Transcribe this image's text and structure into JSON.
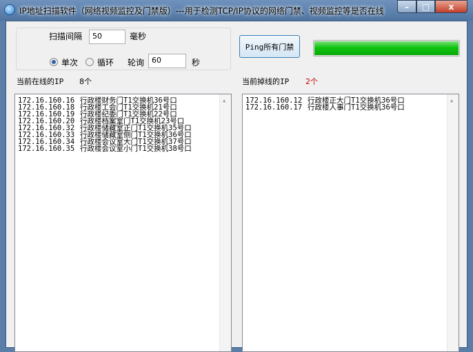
{
  "window": {
    "title": "IP地址扫描软件（网络视频监控及门禁版）---用于检测TCP/IP协议的网络门禁、视频监控等是否在线",
    "minimize": "–",
    "maximize": "□",
    "close": "x"
  },
  "settings": {
    "interval_label": "扫描间隔",
    "interval_value": "50",
    "interval_unit": "毫秒",
    "mode_single": "单次",
    "mode_loop": "循环",
    "mode_selected": "single",
    "poll_label": "轮询",
    "poll_value": "60",
    "poll_unit": "秒"
  },
  "ping_button": "Ping所有门禁",
  "progress": {
    "percent": 100,
    "color": "#0fc40f"
  },
  "online": {
    "label": "当前在线的IP",
    "count": "8个",
    "items": [
      {
        "ip": "172.16.160.16",
        "name": "行政楼财务门T1交换机36号口"
      },
      {
        "ip": "172.16.160.18",
        "name": "行政楼工会门T1交换机21号口"
      },
      {
        "ip": "172.16.160.19",
        "name": "行政楼纪委门T1交换机22号口"
      },
      {
        "ip": "172.16.160.20",
        "name": "行政楼档案室门T1交换机23号口"
      },
      {
        "ip": "172.16.160.32",
        "name": "行政楼储藏室正门T1交换机35号口"
      },
      {
        "ip": "172.16.160.33",
        "name": "行政楼储藏室侧门T1交换机36号口"
      },
      {
        "ip": "172.16.160.34",
        "name": "行政楼会议室大门T1交换机37号口"
      },
      {
        "ip": "172.16.160.35",
        "name": "行政楼会议室小门T1交换机38号口"
      }
    ]
  },
  "offline": {
    "label": "当前掉线的IP",
    "count": "2个",
    "count_color": "#c00000",
    "items": [
      {
        "ip": "172.16.160.12",
        "name": "行政楼正大门T1交换机36号口"
      },
      {
        "ip": "172.16.160.17",
        "name": "行政楼人事门T1交换机36号口"
      }
    ]
  }
}
